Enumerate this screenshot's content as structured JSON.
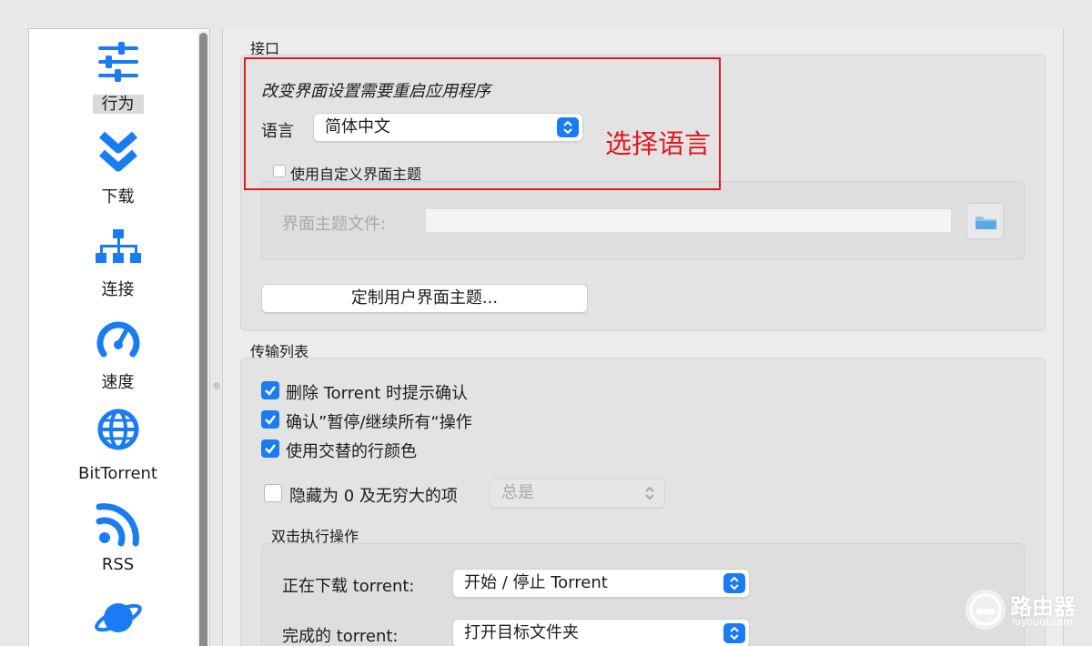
{
  "sidebar": {
    "items": [
      {
        "label": "行为",
        "icon": "sliders-icon",
        "selected": true
      },
      {
        "label": "下载",
        "icon": "double-chevron-down-icon"
      },
      {
        "label": "连接",
        "icon": "network-tree-icon"
      },
      {
        "label": "速度",
        "icon": "speedometer-icon"
      },
      {
        "label": "BitTorrent",
        "icon": "globe-icon"
      },
      {
        "label": "RSS",
        "icon": "rss-icon"
      },
      {
        "label": "",
        "icon": "planet-icon"
      }
    ]
  },
  "interface": {
    "title": "接口",
    "restart_note": "改变界面设置需要重启应用程序",
    "language_label": "语言",
    "language_value": "简体中文",
    "custom_theme_label": "使用自定义界面主题",
    "custom_theme_checked": false,
    "theme_file_label": "界面主题文件:",
    "customize_button": "定制用户界面主题..."
  },
  "transfer_list": {
    "title": "传输列表",
    "confirm_delete": "删除 Torrent 时提示确认",
    "confirm_pause": "确认”暂停/继续所有“操作",
    "alt_row_colors": "使用交替的行颜色",
    "hide_zero": "隐藏为 0 及无穷大的项",
    "hide_zero_value": "总是",
    "double_click_title": "双击执行操作",
    "downloading_label": "正在下载 torrent:",
    "downloading_value": "开始 / 停止 Torrent",
    "completed_label": "完成的 torrent:",
    "completed_value": "打开目标文件夹"
  },
  "annotation": {
    "label": "选择语言",
    "color": "#e0181f"
  },
  "watermark": {
    "text": "路由器",
    "sub": "luyouqi.com"
  },
  "colors": {
    "accent": "#1a7cf3",
    "icon_blue": "#1a7cf3"
  }
}
